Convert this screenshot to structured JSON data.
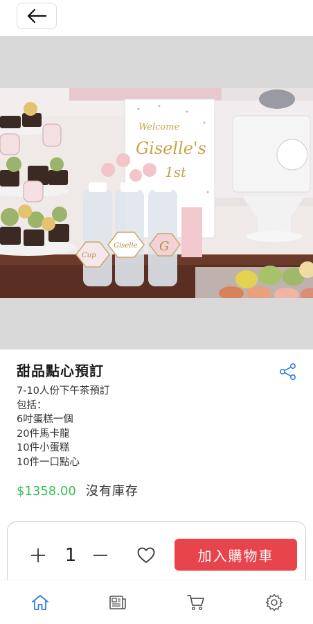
{
  "header": {
    "back_icon": "arrow-left-icon"
  },
  "product": {
    "title": "甜品點心預訂",
    "description_lines": [
      "7-10人份下午茶預訂",
      "包括：",
      "6吋蛋糕一個",
      "20件馬卡龍",
      "10件小蛋糕",
      "10件一口點心"
    ],
    "price": "$1358.00",
    "stock_status": "沒有庫存",
    "share_icon": "share-icon",
    "price_color": "#35c15a"
  },
  "purchase": {
    "plus_icon": "plus-icon",
    "quantity": "1",
    "minus_icon": "minus-icon",
    "favorite_icon": "heart-icon",
    "add_to_cart_label": "加入購物車",
    "button_color": "#e8444c"
  },
  "bottom_nav": {
    "items": [
      {
        "icon": "home-icon",
        "active": true
      },
      {
        "icon": "news-icon",
        "active": false
      },
      {
        "icon": "cart-icon",
        "active": false
      },
      {
        "icon": "settings-icon",
        "active": false
      }
    ],
    "active_color": "#2f7de1"
  }
}
